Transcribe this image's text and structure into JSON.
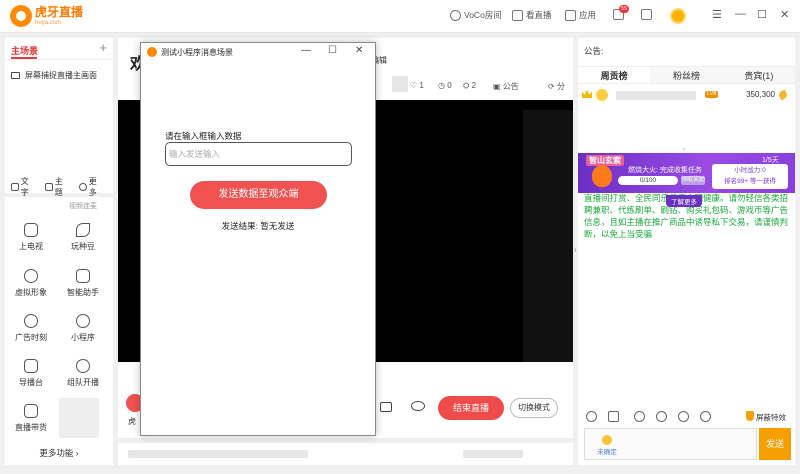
{
  "app": {
    "logo_main": "虎牙直播",
    "logo_sub": "huya.com"
  },
  "topbar": {
    "voco": "VoCo房间",
    "watch": "看直播",
    "apps": "应用",
    "msg_badge": "55",
    "win_min": "—",
    "win_max": "☐",
    "win_close": "✕",
    "win_menu": "☰"
  },
  "left": {
    "tab_main": "主场景",
    "add": "+",
    "source_item": "屏幕捕捉直播主画面",
    "opt_text": "文字",
    "opt_theme": "主题",
    "opt_more": "更多",
    "tools": [
      {
        "label": "视频连麦"
      },
      {
        "label": "上电视"
      },
      {
        "label": "玩种豆"
      },
      {
        "label": "虚拟形象"
      },
      {
        "label": "智能助手"
      },
      {
        "label": "广告时刻"
      },
      {
        "label": "小程序"
      },
      {
        "label": "导播台"
      },
      {
        "label": "组队开播"
      },
      {
        "label": "直播带货"
      }
    ],
    "more_func": "更多功能 ›"
  },
  "center": {
    "title_partial": "欢",
    "edit_partial": "编辑",
    "likes": "1",
    "zero": "0",
    "users": "2",
    "notice": "公告",
    "share_partial": "分",
    "end_live": "结束直播",
    "switch_mode": "切换模式",
    "left_partial": "虎"
  },
  "right": {
    "notice": "公告:",
    "tabs": [
      "周贡榜",
      "粉丝榜",
      "贵宾(1)"
    ],
    "rank_score": "350,300",
    "rank_level": "LV8",
    "banner_tag": "智山玄索",
    "banner_task": "燃烧大火: 完成收集任务",
    "banner_progress": "0/100",
    "banner_btn": "领取奖励",
    "banner_page": "1/5天",
    "banner_right_l1": "小时战力:0",
    "banner_right_l2": "排名99+ 等一获得",
    "banner_more": "了解更多",
    "chat_text": "直播间打赏、全民同乐健康文明健康。请勿轻信各类招聘兼职、代练刷单、刷钻、购买礼包码、游戏币等广告信息，且如主播在推广商品中诱导私下交易，请谨慎判断，以免上当受骗",
    "shield": "屏蔽特效",
    "uncert": "未确定",
    "send": "发送"
  },
  "dialog": {
    "title": "测试小程序消息场景",
    "ctl_min": "—",
    "ctl_max": "☐",
    "ctl_close": "✕",
    "label": "请在输入框输入数据",
    "placeholder": "输入发送输入",
    "send_btn": "发送数据至观众端",
    "result": "发送结果:   暂无发送"
  }
}
